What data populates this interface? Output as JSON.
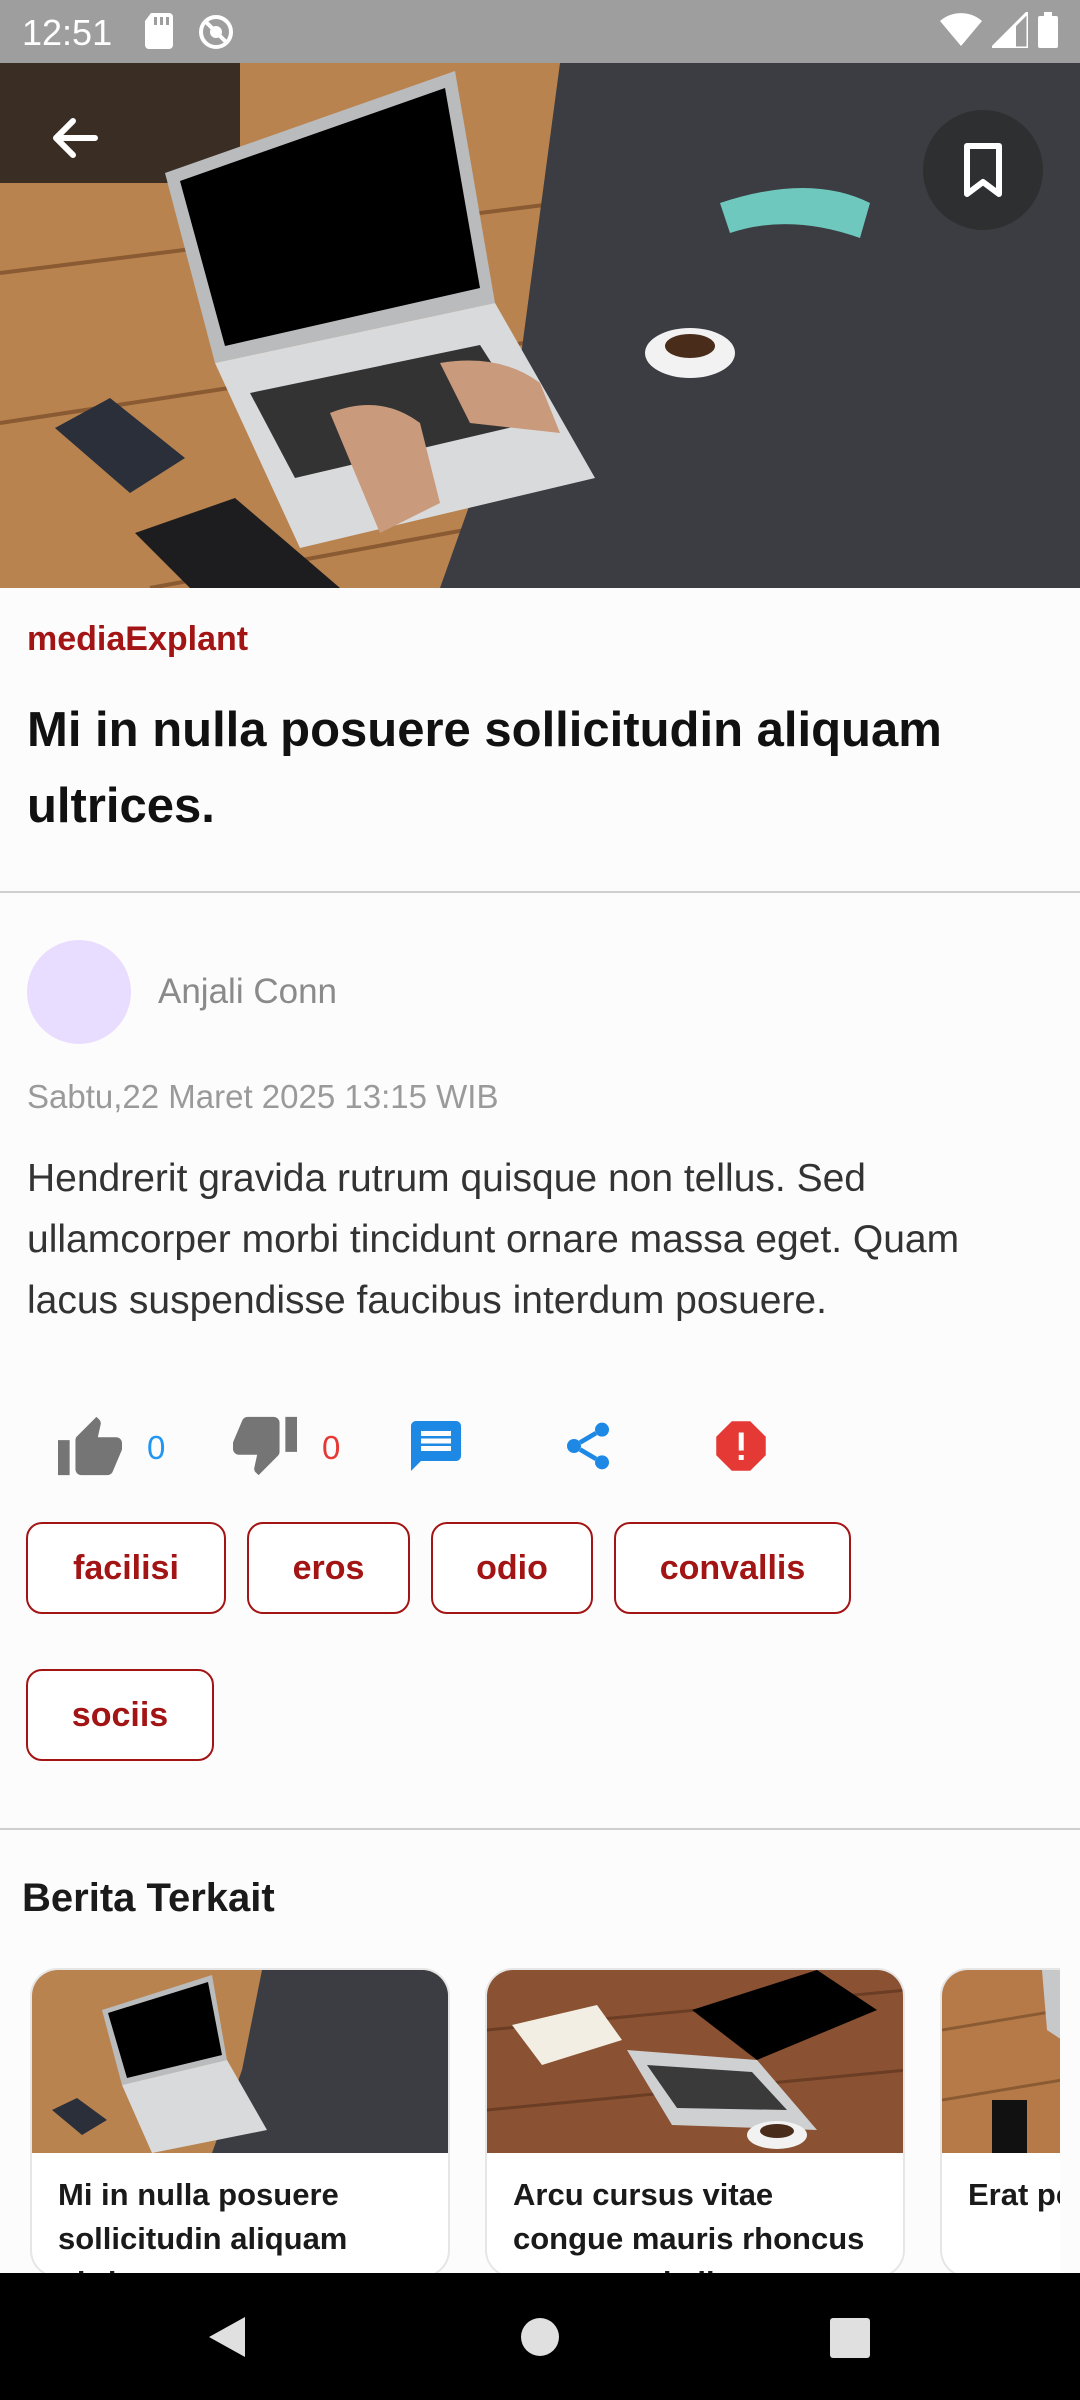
{
  "status_bar": {
    "time": "12:51"
  },
  "article": {
    "source": "mediaExplant",
    "headline": "Mi in nulla posuere sollicitudin aliquam ultrices.",
    "author": "Anjali Conn",
    "date": "Sabtu,22 Maret 2025 13:15 WIB",
    "body": "Hendrerit gravida rutrum quisque non tellus. Sed ullamcorper morbi tincidunt ornare massa eget. Quam lacus suspendisse faucibus interdum posuere."
  },
  "actions": {
    "likes": "0",
    "dislikes": "0"
  },
  "tags": [
    "facilisi",
    "eros",
    "odio",
    "convallis",
    "sociis"
  ],
  "related": {
    "title": "Berita Terkait",
    "cards": [
      {
        "title": "Mi in nulla posuere sollicitudin aliquam ultrices."
      },
      {
        "title": "Arcu cursus vitae congue mauris rhoncus aenean vel elit scelerisque."
      },
      {
        "title": "Erat pellentesque adipiscing commodo elit at imperdiet."
      }
    ]
  },
  "colors": {
    "accent": "#a31414",
    "like": "#2196f3",
    "dislike": "#e53935"
  },
  "icons": {
    "back": "arrow-left-icon",
    "bookmark": "bookmark-icon",
    "like": "thumb-up-icon",
    "dislike": "thumb-down-icon",
    "comment": "comment-icon",
    "share": "share-icon",
    "report": "alert-icon"
  }
}
